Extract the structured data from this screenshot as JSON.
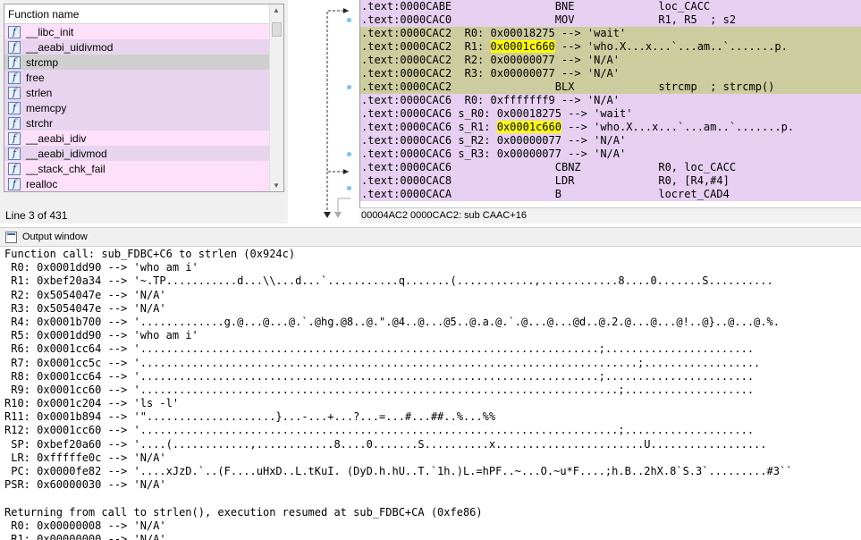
{
  "function_window": {
    "header": "Function name",
    "functions": [
      {
        "name": "__libc_init",
        "style": "pink"
      },
      {
        "name": "__aeabi_uidivmod",
        "style": "lav"
      },
      {
        "name": "strcmp",
        "style": "sel"
      },
      {
        "name": "free",
        "style": "lav"
      },
      {
        "name": "strlen",
        "style": "lav"
      },
      {
        "name": "memcpy",
        "style": "lav"
      },
      {
        "name": "strchr",
        "style": "lav"
      },
      {
        "name": "__aeabi_idiv",
        "style": "pink"
      },
      {
        "name": "__aeabi_idivmod",
        "style": "lav"
      },
      {
        "name": "__stack_chk_fail",
        "style": "pink"
      },
      {
        "name": "realloc",
        "style": "pink"
      }
    ],
    "function_icon": "function-f-icon",
    "status": "Line 3 of 431"
  },
  "disassembly": {
    "lines": [
      {
        "seg": ".text:0000CABE",
        "body": "                BNE             loc_CACC",
        "style": "lav"
      },
      {
        "seg": ".text:0000CAC0",
        "body": "                MOV             R1, R5  ; s2",
        "style": "lav"
      },
      {
        "seg": ".text:0000CAC2",
        "body": "  R0: 0x00018275 --> 'wait'",
        "style": "olive"
      },
      {
        "seg": ".text:0000CAC2",
        "body": "  R1: ",
        "hl": "0x0001c660",
        "tail": " --> 'who.X...x...`...am..`.......p.",
        "style": "olive"
      },
      {
        "seg": ".text:0000CAC2",
        "body": "  R2: 0x00000077 --> 'N/A'",
        "style": "olive"
      },
      {
        "seg": ".text:0000CAC2",
        "body": "  R3: 0x00000077 --> 'N/A'",
        "style": "olive"
      },
      {
        "seg": ".text:0000CAC2",
        "body": "                BLX             strcmp  ; strcmp()",
        "style": "olive"
      },
      {
        "seg": ".text:0000CAC6",
        "body": "  R0: 0xfffffff9 --> 'N/A'",
        "style": "lav"
      },
      {
        "seg": ".text:0000CAC6",
        "body": " s_R0: 0x00018275 --> 'wait'",
        "style": "lav"
      },
      {
        "seg": ".text:0000CAC6",
        "body": " s_R1: ",
        "hl": "0x0001c660",
        "tail": " --> 'who.X...x...`...am..`.......p.",
        "style": "lav"
      },
      {
        "seg": ".text:0000CAC6",
        "body": " s_R2: 0x00000077 --> 'N/A'",
        "style": "lav"
      },
      {
        "seg": ".text:0000CAC6",
        "body": " s_R3: 0x00000077 --> 'N/A'",
        "style": "lav"
      },
      {
        "seg": ".text:0000CAC6",
        "body": "                CBNZ            R0, loc_CACC",
        "style": "lav"
      },
      {
        "seg": ".text:0000CAC8",
        "body": "                LDR             R0, [R4,#4]",
        "style": "lav"
      },
      {
        "seg": ".text:0000CACA",
        "body": "                B               locret_CAD4",
        "style": "lav"
      }
    ],
    "status": "00004AC2 0000CAC2: sub CAAC+16"
  },
  "output_window": {
    "title": "Output window",
    "icon": "output-window-icon",
    "lines": [
      "Function call: sub_FDBC+C6 to strlen (0x924c)",
      " R0: 0x0001dd90 --> 'who am i'",
      " R1: 0xbef20a34 --> '~.TP...........d...\\\\...d...`...........q.......(............,............8....0.......S..........",
      " R2: 0x5054047e --> 'N/A'",
      " R3: 0x5054047e --> 'N/A'",
      " R4: 0x0001b700 --> '.............g.@...@...@.`.@hg.@8..@.\".@4..@...@5..@.a.@.`.@...@...@d..@.2.@...@...@!..@}..@...@.%.",
      " R5: 0x0001dd90 --> 'who am i'",
      " R6: 0x0001cc64 --> '.......................................................................;.......................",
      " R7: 0x0001cc5c --> '.............................................................................;..................",
      " R8: 0x0001cc64 --> '.......................................................................;.......................",
      " R9: 0x0001cc60 --> '..........................................................................;....................",
      "R10: 0x0001c204 --> 'ls -l'",
      "R11: 0x0001b894 --> '\"....................}...-...+...?...=...#...##..%...%%",
      "R12: 0x0001cc60 --> '..........................................................................;....................",
      " SP: 0xbef20a60 --> '....(............,............8....0.......S..........x.......................U..................",
      " LR: 0xfffffe0c --> 'N/A'",
      " PC: 0x0000fe82 --> '....xJzD.`..(F....uHxD..L.tKuI. (DyD.h.hU..T.`1h.)L.=hPF..~...O.~u*F....;h.B..2hX.8`S.3`.........#3``",
      "PSR: 0x60000030 --> 'N/A'",
      "",
      "Returning from call to strlen(), execution resumed at sub_FDBC+CA (0xfe86)",
      " R0: 0x00000008 --> 'N/A'",
      " R1: 0x00000000 --> 'N/A'"
    ]
  }
}
